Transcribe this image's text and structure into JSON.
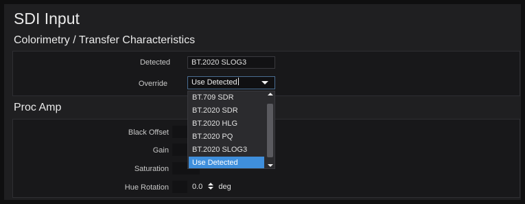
{
  "page": {
    "title": "SDI Input"
  },
  "colorimetry": {
    "heading": "Colorimetry / Transfer Characteristics",
    "detected_label": "Detected",
    "detected_value": "BT.2020 SLOG3",
    "override_label": "Override",
    "override_value": "Use Detected",
    "options": [
      "BT.709 SDR",
      "BT.2020 SDR",
      "BT.2020 HLG",
      "BT.2020 PQ",
      "BT.2020 SLOG3",
      "Use Detected"
    ],
    "selected_option": "Use Detected"
  },
  "proc_amp": {
    "heading": "Proc Amp",
    "black_offset_label": "Black Offset",
    "gain_label": "Gain",
    "saturation_label": "Saturation",
    "hue_rotation_label": "Hue Rotation",
    "hue_rotation_value": "0.0",
    "hue_rotation_unit": "deg"
  },
  "colors": {
    "accent": "#3f8fdc",
    "panel": "#1f1f21",
    "group": "#18181a"
  }
}
